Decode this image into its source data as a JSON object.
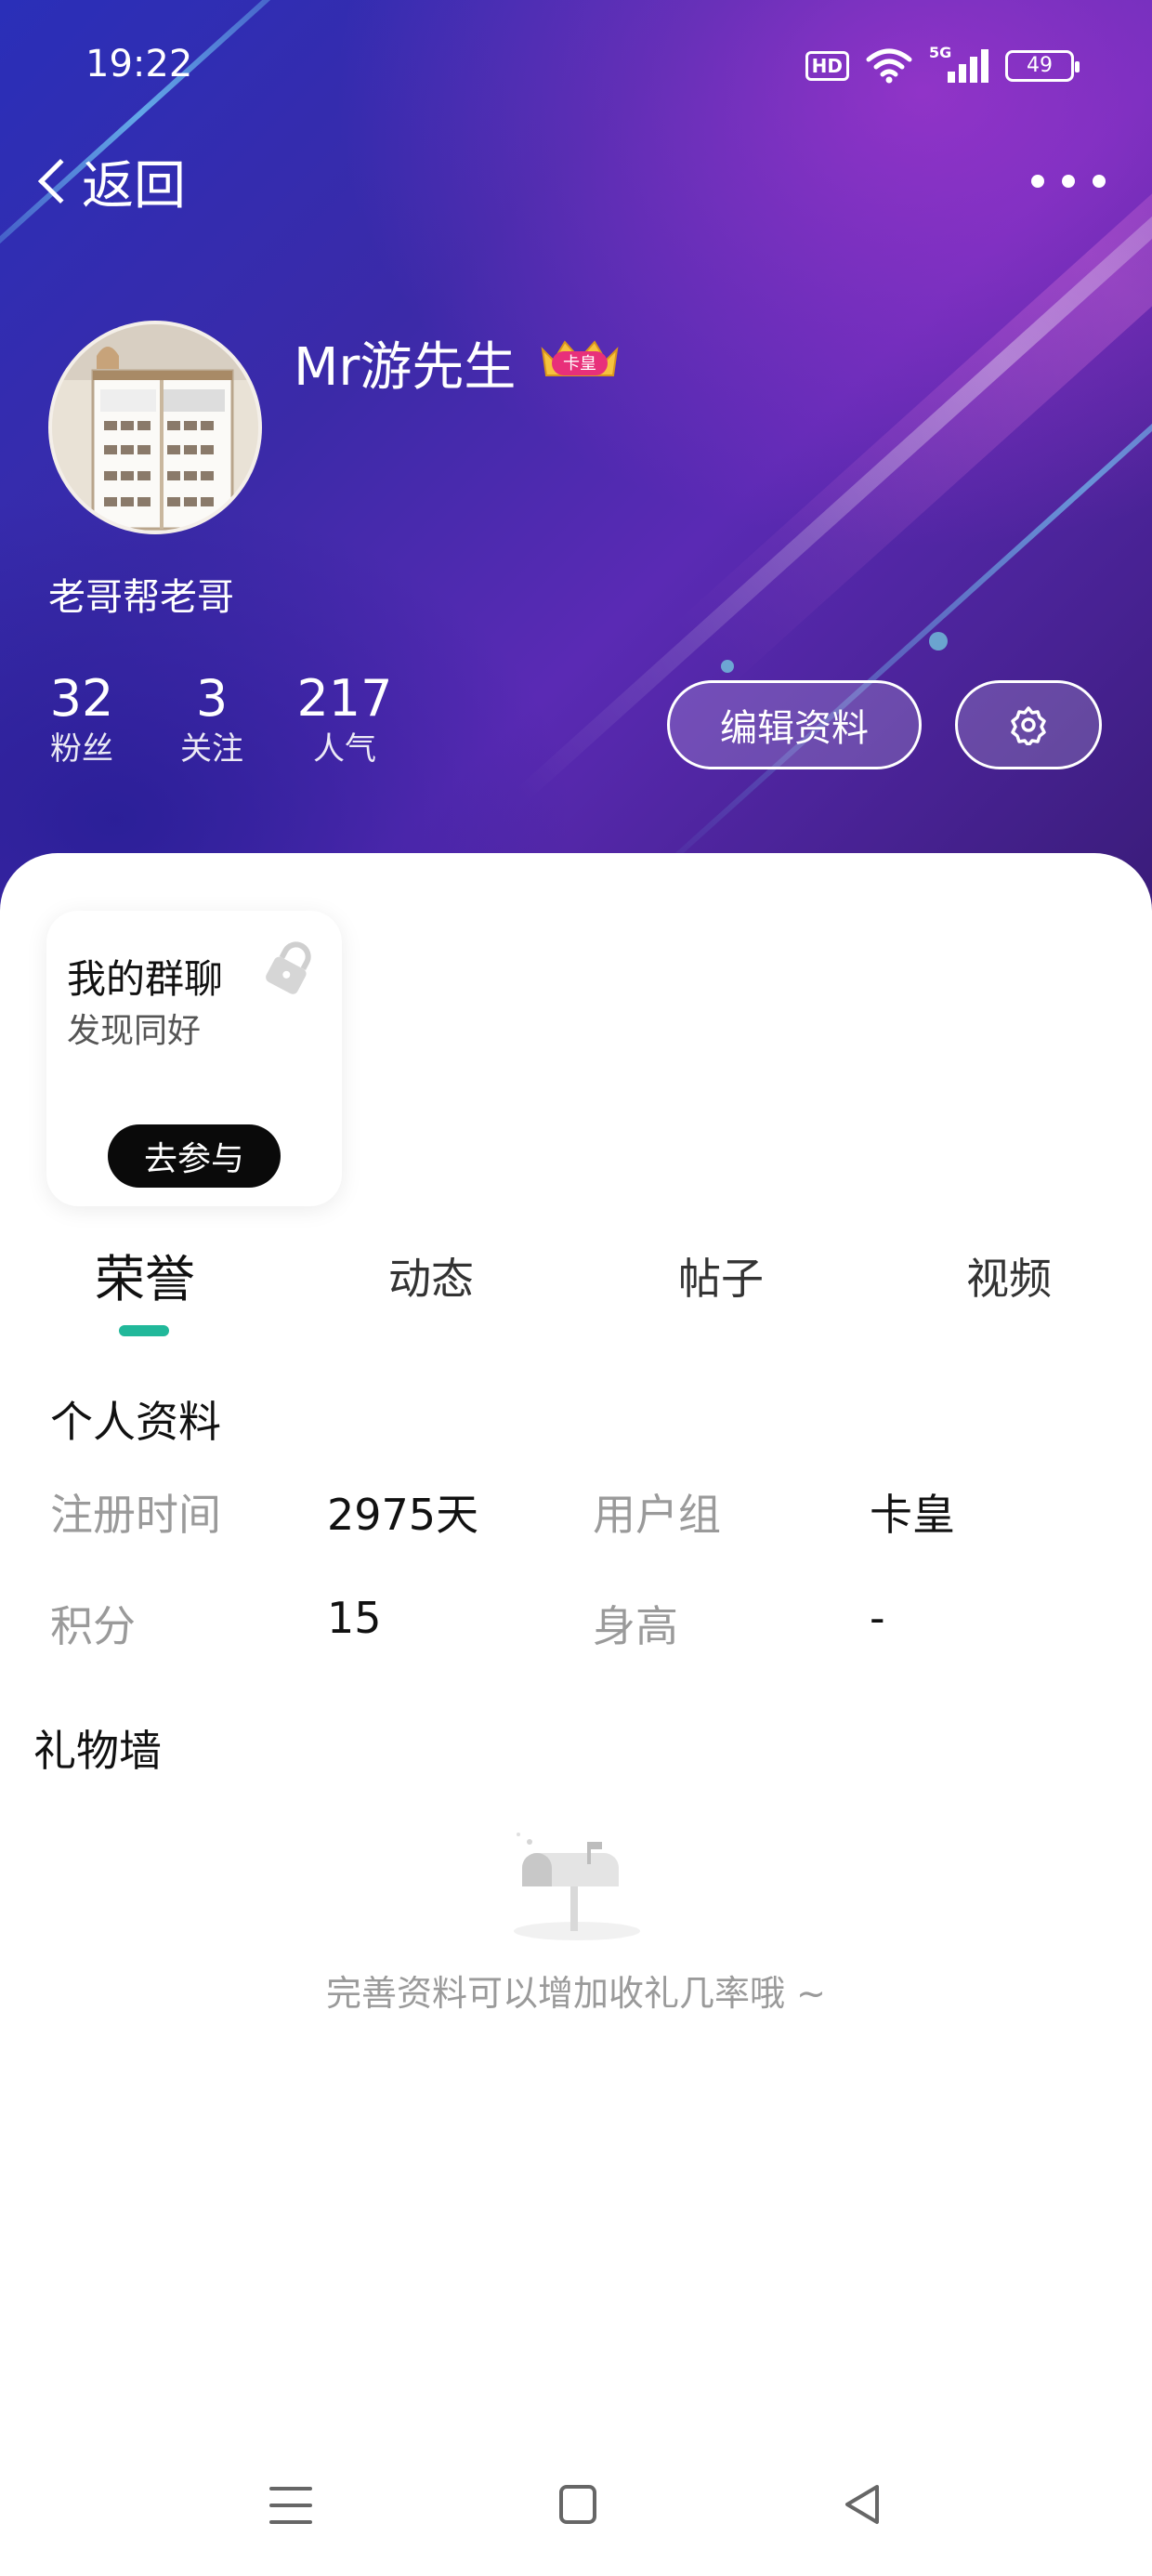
{
  "status_bar": {
    "time": "19:22",
    "hd": "HD",
    "network": "5G",
    "battery": "49"
  },
  "nav": {
    "back_label": "返回",
    "back_icon": "chevron-left-icon",
    "more_icon": "more-dots-icon"
  },
  "profile": {
    "username": "Mr游先生",
    "badge": "卡皇",
    "signature": "老哥帮老哥",
    "stats": [
      {
        "value": "32",
        "label": "粉丝"
      },
      {
        "value": "3",
        "label": "关注"
      },
      {
        "value": "217",
        "label": "人气"
      }
    ],
    "edit_label": "编辑资料",
    "settings_icon": "gear-icon"
  },
  "group_card": {
    "title": "我的群聊",
    "subtitle": "发现同好",
    "join_label": "去参与",
    "lock_icon": "lock-icon"
  },
  "tabs": [
    {
      "label": "荣誉",
      "active": true
    },
    {
      "label": "动态",
      "active": false
    },
    {
      "label": "帖子",
      "active": false
    },
    {
      "label": "视频",
      "active": false
    }
  ],
  "personal_info": {
    "title": "个人资料",
    "register_label": "注册时间",
    "register_value": "2975天",
    "group_label": "用户组",
    "group_value": "卡皇",
    "points_label": "积分",
    "points_value": "15",
    "height_label": "身高",
    "height_value": "-"
  },
  "gift_wall": {
    "title": "礼物墙",
    "empty_text": "完善资料可以增加收礼几率哦 ~",
    "empty_icon": "mailbox-icon"
  },
  "colors": {
    "accent": "#21b89a",
    "join_button": "#0a0a0a",
    "muted_text": "#9a9a9a"
  }
}
